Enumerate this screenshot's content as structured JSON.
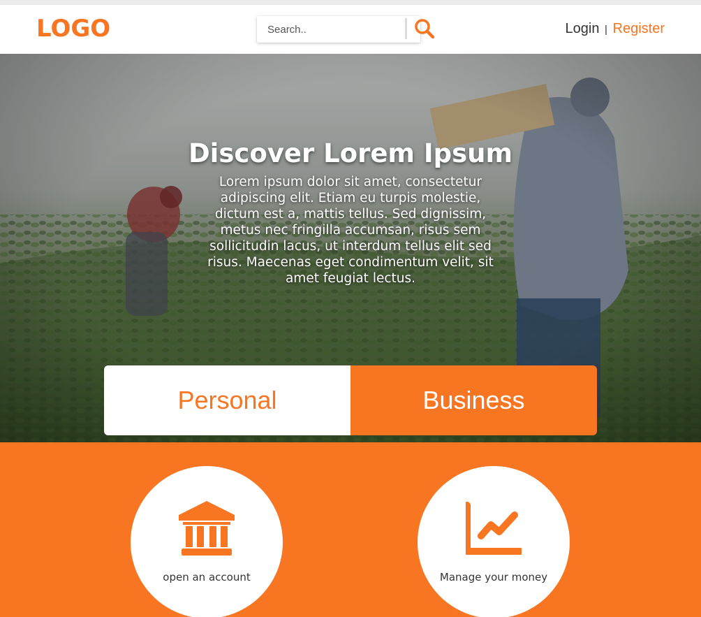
{
  "header": {
    "logo": "LOGO",
    "search": {
      "placeholder": "Search..",
      "value": ""
    },
    "search_icon": "search-icon",
    "login_label": "Login",
    "separator": "|",
    "register_label": "Register"
  },
  "hero": {
    "title": "Discover Lorem Ipsum",
    "body": "Lorem ipsum dolor sit amet, consectetur adipiscing elit. Etiam eu turpis molestie, dictum est a, mattis tellus. Sed dignissim, metus nec fringilla accumsan, risus sem sollicitudin lacus, ut interdum tellus elit sed risus. Maecenas eget condimentum velit, sit amet feugiat lectus."
  },
  "tabs": [
    {
      "label": "Personal",
      "active": false
    },
    {
      "label": "Business",
      "active": true
    }
  ],
  "features": [
    {
      "icon": "bank-icon",
      "label": "open an account"
    },
    {
      "icon": "chart-line-icon",
      "label": "Manage your money"
    }
  ],
  "colors": {
    "accent": "#f87522",
    "text": "#333333",
    "white": "#ffffff"
  }
}
